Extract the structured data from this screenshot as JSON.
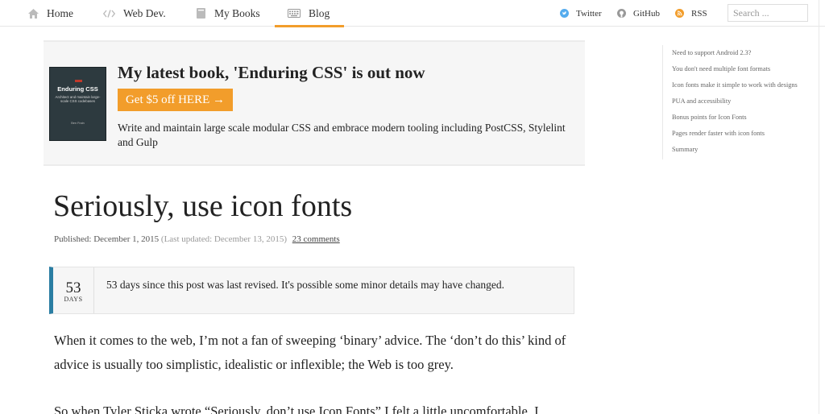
{
  "nav": {
    "items": [
      {
        "label": "Home",
        "icon": "home-icon"
      },
      {
        "label": "Web Dev.",
        "icon": "code-icon"
      },
      {
        "label": "My Books",
        "icon": "book-icon"
      },
      {
        "label": "Blog",
        "icon": "keyboard-icon",
        "active": true
      }
    ],
    "social": [
      {
        "label": "Twitter",
        "icon": "twitter-icon",
        "color": "#55acee"
      },
      {
        "label": "GitHub",
        "icon": "github-icon",
        "color": "#999999"
      },
      {
        "label": "RSS",
        "icon": "rss-icon",
        "color": "#f29d2b"
      }
    ],
    "search_placeholder": "Search ..."
  },
  "banner": {
    "heading_pre": "My latest book, '",
    "heading_book": "Enduring CSS",
    "heading_post": "' is out now",
    "cta_label": "Get $5 off HERE →",
    "description": "Write and maintain large scale modular CSS and embrace modern tooling including PostCSS, Stylelint and Gulp",
    "cover": {
      "title": "Enduring CSS",
      "subtitle": "Architect and maintain large-scale CSS codebases",
      "author": "Ben Frain"
    },
    "accent": "#f29d2b"
  },
  "post": {
    "title": "Seriously, use icon fonts",
    "published": "Published: December 1, 2015",
    "updated": "(Last updated: December 13, 2015)",
    "comments": "23 comments",
    "notice": {
      "days": "53",
      "days_label": "DAYS",
      "text": "53 days since this post was last revised. It's possible some minor details may have changed.",
      "accent": "#2b7ea3"
    },
    "paragraphs": [
      "When it comes to the web, I’m not a fan of sweeping ‘binary’ advice. The ‘don’t do this’ kind of advice is usually too simplistic, idealistic or inflexible; the Web is too grey.",
      "So when Tyler Sticka wrote “Seriously, don’t use Icon Fonts” I felt a little uncomfortable. I"
    ]
  },
  "toc": [
    "Need to support Android 2.3?",
    "You don't need multiple font formats",
    "Icon fonts make it simple to work with designs",
    "PUA and accessibility",
    "Bonus points for Icon Fonts",
    "Pages render faster with icon fonts",
    "Summary"
  ]
}
